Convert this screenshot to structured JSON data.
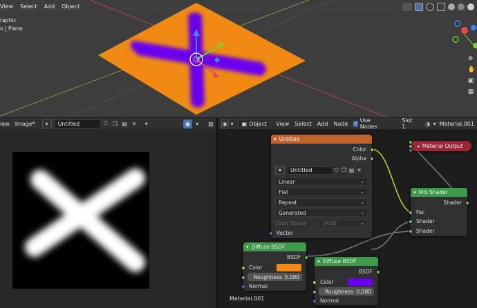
{
  "viewport": {
    "menu": [
      "View",
      "Select",
      "Add",
      "Object"
    ],
    "overlay_line1": "raphic",
    "overlay_line2": "n | Plane"
  },
  "image_editor": {
    "menu_view": "iew",
    "menu_image": "Image*",
    "image_name": "Untitled"
  },
  "node_editor": {
    "object_mode": "Object",
    "menu": [
      "View",
      "Select",
      "Add",
      "Node"
    ],
    "use_nodes_label": "Use Nodes",
    "slot": "Slot 1",
    "material": "Material.001",
    "footer_material": "Material.001",
    "image_node": {
      "title": "Untitled",
      "out_color": "Color",
      "out_alpha": "Alpha",
      "image_name": "Untitled",
      "interpolation": "Linear",
      "projection": "Flat",
      "extension": "Repeat",
      "source": "Generated",
      "color_space_label": "Color Space",
      "color_space_value": "sRGB",
      "in_vector": "Vector"
    },
    "material_output": {
      "title": "Material Output"
    },
    "mix_shader": {
      "title": "Mix Shader",
      "out_shader": "Shader",
      "in_fac": "Fac",
      "in_shader1": "Shader",
      "in_shader2": "Shader"
    },
    "diffuse1": {
      "title": "Diffuse BSDF",
      "out": "BSDF",
      "color_label": "Color",
      "color_hex": "#f08a12",
      "roughness_label": "Roughness",
      "roughness_value": "0.000",
      "normal_label": "Normal"
    },
    "diffuse2": {
      "title": "Diffuse BSDF",
      "out": "BSDF",
      "color_label": "Color",
      "color_hex": "#6a00f0",
      "roughness_label": "Roughness",
      "roughness_value": "0.000",
      "normal_label": "Normal"
    }
  },
  "colors": {
    "plane_orange": "#f08a12",
    "cross_purple": "#6a00f0",
    "node_image_header": "#c0622c",
    "node_shader_header": "#3c9a4a",
    "node_output_header": "#9b2536",
    "socket_yellow": "#c7c729",
    "socket_green": "#63c763",
    "socket_gray": "#a1a1a1",
    "socket_purple": "#6363c7"
  }
}
